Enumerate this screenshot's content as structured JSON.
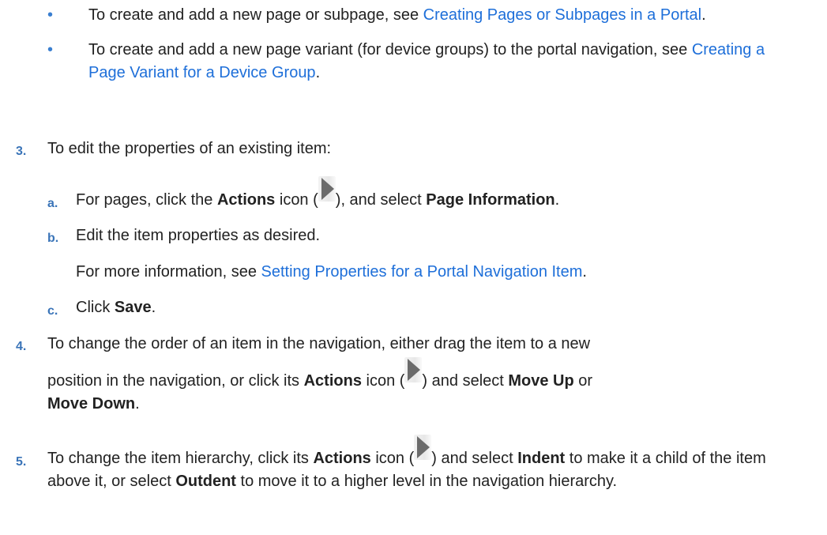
{
  "bullets": [
    {
      "text": "To create and add a new page or subpage, see ",
      "link": "Creating Pages or Subpages in a Portal",
      "after": "."
    },
    {
      "text": "To create and add a new page variant (for device groups) to the portal navigation, see ",
      "link": "Creating a Page Variant for a Device Group",
      "after": "."
    }
  ],
  "step3": {
    "num": "3.",
    "text": "To edit the properties of an existing item:",
    "a": {
      "label": "a.",
      "t1": "For pages, click the ",
      "b1": "Actions",
      "t2": " icon (",
      "t3": "), and select ",
      "b2": "Page Information",
      "t4": "."
    },
    "b": {
      "label": "b.",
      "text": "Edit the item properties as desired."
    },
    "b_info": {
      "t1": "For more information, see ",
      "link": "Setting Properties for a Portal Navigation Item",
      "t2": "."
    },
    "c": {
      "label": "c.",
      "t1": "Click ",
      "b1": "Save",
      "t2": "."
    }
  },
  "step4": {
    "num": "4.",
    "line1": "To change the order of an item in the navigation, either drag the item to a new",
    "t1": "position in the navigation, or click its ",
    "b1": "Actions",
    "t2": " icon (",
    "t3": ") and select ",
    "b2": "Move Up",
    "t4": " or",
    "b3": "Move Down",
    "t5": "."
  },
  "step5": {
    "num": "5.",
    "t1": "To change the item hierarchy, click its ",
    "b1": "Actions",
    "t2": " icon (",
    "t3": ") and select ",
    "b2": "Indent",
    "t4": " to make it a child of the item above it, or select ",
    "b3": "Outdent",
    "t5": " to move it to a higher level in the navigation hierarchy."
  },
  "icons": {
    "actions": "actions-icon"
  }
}
